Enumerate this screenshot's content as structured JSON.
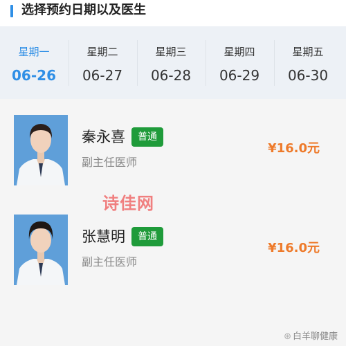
{
  "header": {
    "title": "选择预约日期以及医生"
  },
  "colors": {
    "accent": "#2f8fe6",
    "price": "#ee7a2a",
    "badge": "#1f9b3a"
  },
  "dates": [
    {
      "weekday": "星期一",
      "date": "06-26",
      "active": true
    },
    {
      "weekday": "星期二",
      "date": "06-27",
      "active": false
    },
    {
      "weekday": "星期三",
      "date": "06-28",
      "active": false
    },
    {
      "weekday": "星期四",
      "date": "06-29",
      "active": false
    },
    {
      "weekday": "星期五",
      "date": "06-30",
      "active": false
    }
  ],
  "doctors": [
    {
      "name": "秦永喜",
      "badge": "普通",
      "title": "副主任医师",
      "price": "¥16.0元"
    },
    {
      "name": "张慧明",
      "badge": "普通",
      "title": "副主任医师",
      "price": "¥16.0元"
    }
  ],
  "watermarks": {
    "center": "诗佳网",
    "corner": "白羊聊健康"
  }
}
